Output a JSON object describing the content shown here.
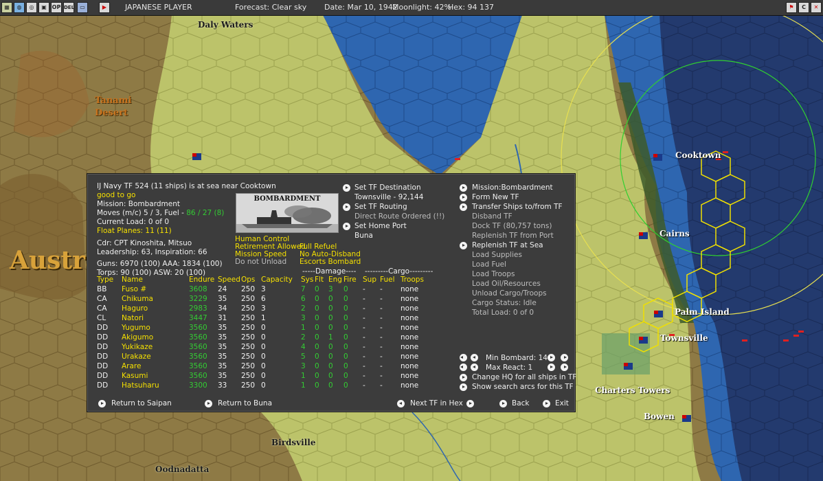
{
  "topbar": {
    "player": "JAPANESE PLAYER",
    "forecast": "Forecast: Clear sky",
    "date": "Date: Mar 10, 1942",
    "moonlight": "Moonlight: 42%",
    "hex": "Hex: 94 137",
    "icons": [
      "map-icon",
      "globe-icon",
      "target-icon",
      "op-icon",
      "del-icon",
      "monitor-icon",
      "play-icon"
    ],
    "right_icons": [
      "flag-icon",
      "c-icon",
      "close-icon"
    ],
    "icon_labels": {
      "op": "OP",
      "del": "DEL",
      "c": "C"
    }
  },
  "map": {
    "labels": {
      "daly_waters": "Daly Waters",
      "tanami": "Tanami",
      "desert": "Desert",
      "austra": "Austra",
      "cooktown": "Cooktown",
      "cairns": "Cairns",
      "palm_island": "Palm Island",
      "townsville": "Townsville",
      "charters_towers": "Charters Towers",
      "bowen": "Bowen",
      "birdsville": "Birdsville",
      "oodnadatta": "Oodnadatta"
    }
  },
  "dialog": {
    "header": {
      "title": "IJ Navy TF 524 (11 ships) is at sea near Cooktown",
      "status": "good to go",
      "mission": "Mission: Bombardment",
      "moves_prefix": "Moves (m/c)  5 / 3, Fuel - ",
      "moves_fuel": "86 / 27 (8)",
      "current_load": "Current Load:  0 of 0",
      "float_planes": "Float Planes: 11 (11)",
      "cdr": "Cdr: CPT  Kinoshita, Mitsuo",
      "leadership": "Leadership: 63, Inspiration: 66",
      "guns": "Guns: 6970 (100)   AAA: 1834 (100)",
      "torps": "Torps: 90 (100)     ASW: 20 (100)"
    },
    "image_caption": "BOMBARDMENT",
    "flags": {
      "human_control": "Human Control",
      "retirement": "Retirement Allowed",
      "full_refuel": "Full Refuel",
      "mission_speed": "Mission Speed",
      "no_auto_disband": "No Auto-Disband",
      "do_not_unload": "Do not Unload",
      "escorts_bombard": "Escorts Bombard"
    },
    "middle": {
      "set_dest": "Set TF Destination",
      "dest_value": "Townsville - 92,144",
      "set_routing": "Set TF Routing",
      "direct_route": "Direct Route Ordered (!!)",
      "set_home": "Set Home Port",
      "home_value": "Buna"
    },
    "right": {
      "mission": "Mission:Bombardment",
      "form_new": "Form New TF",
      "transfer": "Transfer Ships to/from TF",
      "disband": "Disband TF",
      "dock": "Dock TF (80,757 tons)",
      "replenish_port": "Replenish TF from Port",
      "replenish_sea": "Replenish TF at Sea",
      "load_supplies": "Load Supplies",
      "load_fuel": "Load Fuel",
      "load_troops": "Load Troops",
      "load_oil": "Load Oil/Resources",
      "unload": "Unload Cargo/Troops",
      "cargo_status": "Cargo Status: Idle",
      "total_load": "Total Load: 0 of 0",
      "min_bombard": "Min Bombard:  14",
      "max_react": "Max React:  1",
      "change_hq": "Change HQ for all ships in TF",
      "show_arcs": "Show search arcs for this TF"
    },
    "table": {
      "group_damage": "-----Damage----",
      "group_cargo": "---------Cargo---------",
      "headers": [
        "Type",
        "Name",
        "Endure",
        "Speed",
        "Ops",
        "Capacity",
        "Sys",
        "Flt",
        "Eng",
        "Fire",
        "Sup",
        "Fuel",
        "Troops"
      ],
      "rows": [
        [
          "BB",
          "Fuso #",
          "3608",
          "24",
          "250",
          "3",
          "7",
          "0",
          "3",
          "0",
          "-",
          "-",
          "none"
        ],
        [
          "CA",
          "Chikuma",
          "3229",
          "35",
          "250",
          "6",
          "6",
          "0",
          "0",
          "0",
          "-",
          "-",
          "none"
        ],
        [
          "CA",
          "Haguro",
          "2983",
          "34",
          "250",
          "3",
          "2",
          "0",
          "0",
          "0",
          "-",
          "-",
          "none"
        ],
        [
          "CL",
          "Natori",
          "3447",
          "31",
          "250",
          "1",
          "3",
          "0",
          "0",
          "0",
          "-",
          "-",
          "none"
        ],
        [
          "DD",
          "Yugumo",
          "3560",
          "35",
          "250",
          "0",
          "1",
          "0",
          "0",
          "0",
          "-",
          "-",
          "none"
        ],
        [
          "DD",
          "Akigumo",
          "3560",
          "35",
          "250",
          "0",
          "2",
          "0",
          "1",
          "0",
          "-",
          "-",
          "none"
        ],
        [
          "DD",
          "Yukikaze",
          "3560",
          "35",
          "250",
          "0",
          "4",
          "0",
          "0",
          "0",
          "-",
          "-",
          "none"
        ],
        [
          "DD",
          "Urakaze",
          "3560",
          "35",
          "250",
          "0",
          "5",
          "0",
          "0",
          "0",
          "-",
          "-",
          "none"
        ],
        [
          "DD",
          "Arare",
          "3560",
          "35",
          "250",
          "0",
          "3",
          "0",
          "0",
          "0",
          "-",
          "-",
          "none"
        ],
        [
          "DD",
          "Kasumi",
          "3560",
          "35",
          "250",
          "0",
          "1",
          "0",
          "0",
          "0",
          "-",
          "-",
          "none"
        ],
        [
          "DD",
          "Hatsuharu",
          "3300",
          "33",
          "250",
          "0",
          "1",
          "0",
          "0",
          "0",
          "-",
          "-",
          "none"
        ]
      ]
    },
    "footer": {
      "return_saipan": "Return to Saipan",
      "return_buna": "Return to Buna",
      "next_tf": "Next TF in Hex",
      "back": "Back",
      "exit": "Exit"
    }
  },
  "colors": {
    "ocean_deep": "#233a6e",
    "ocean": "#2e66b0",
    "land": "#bcc36a",
    "desert": "#9a7a3a",
    "highlight_yellow": "#f5e000",
    "highlight_green": "#33cc33",
    "dialog_bg": "#3c3c3c"
  }
}
